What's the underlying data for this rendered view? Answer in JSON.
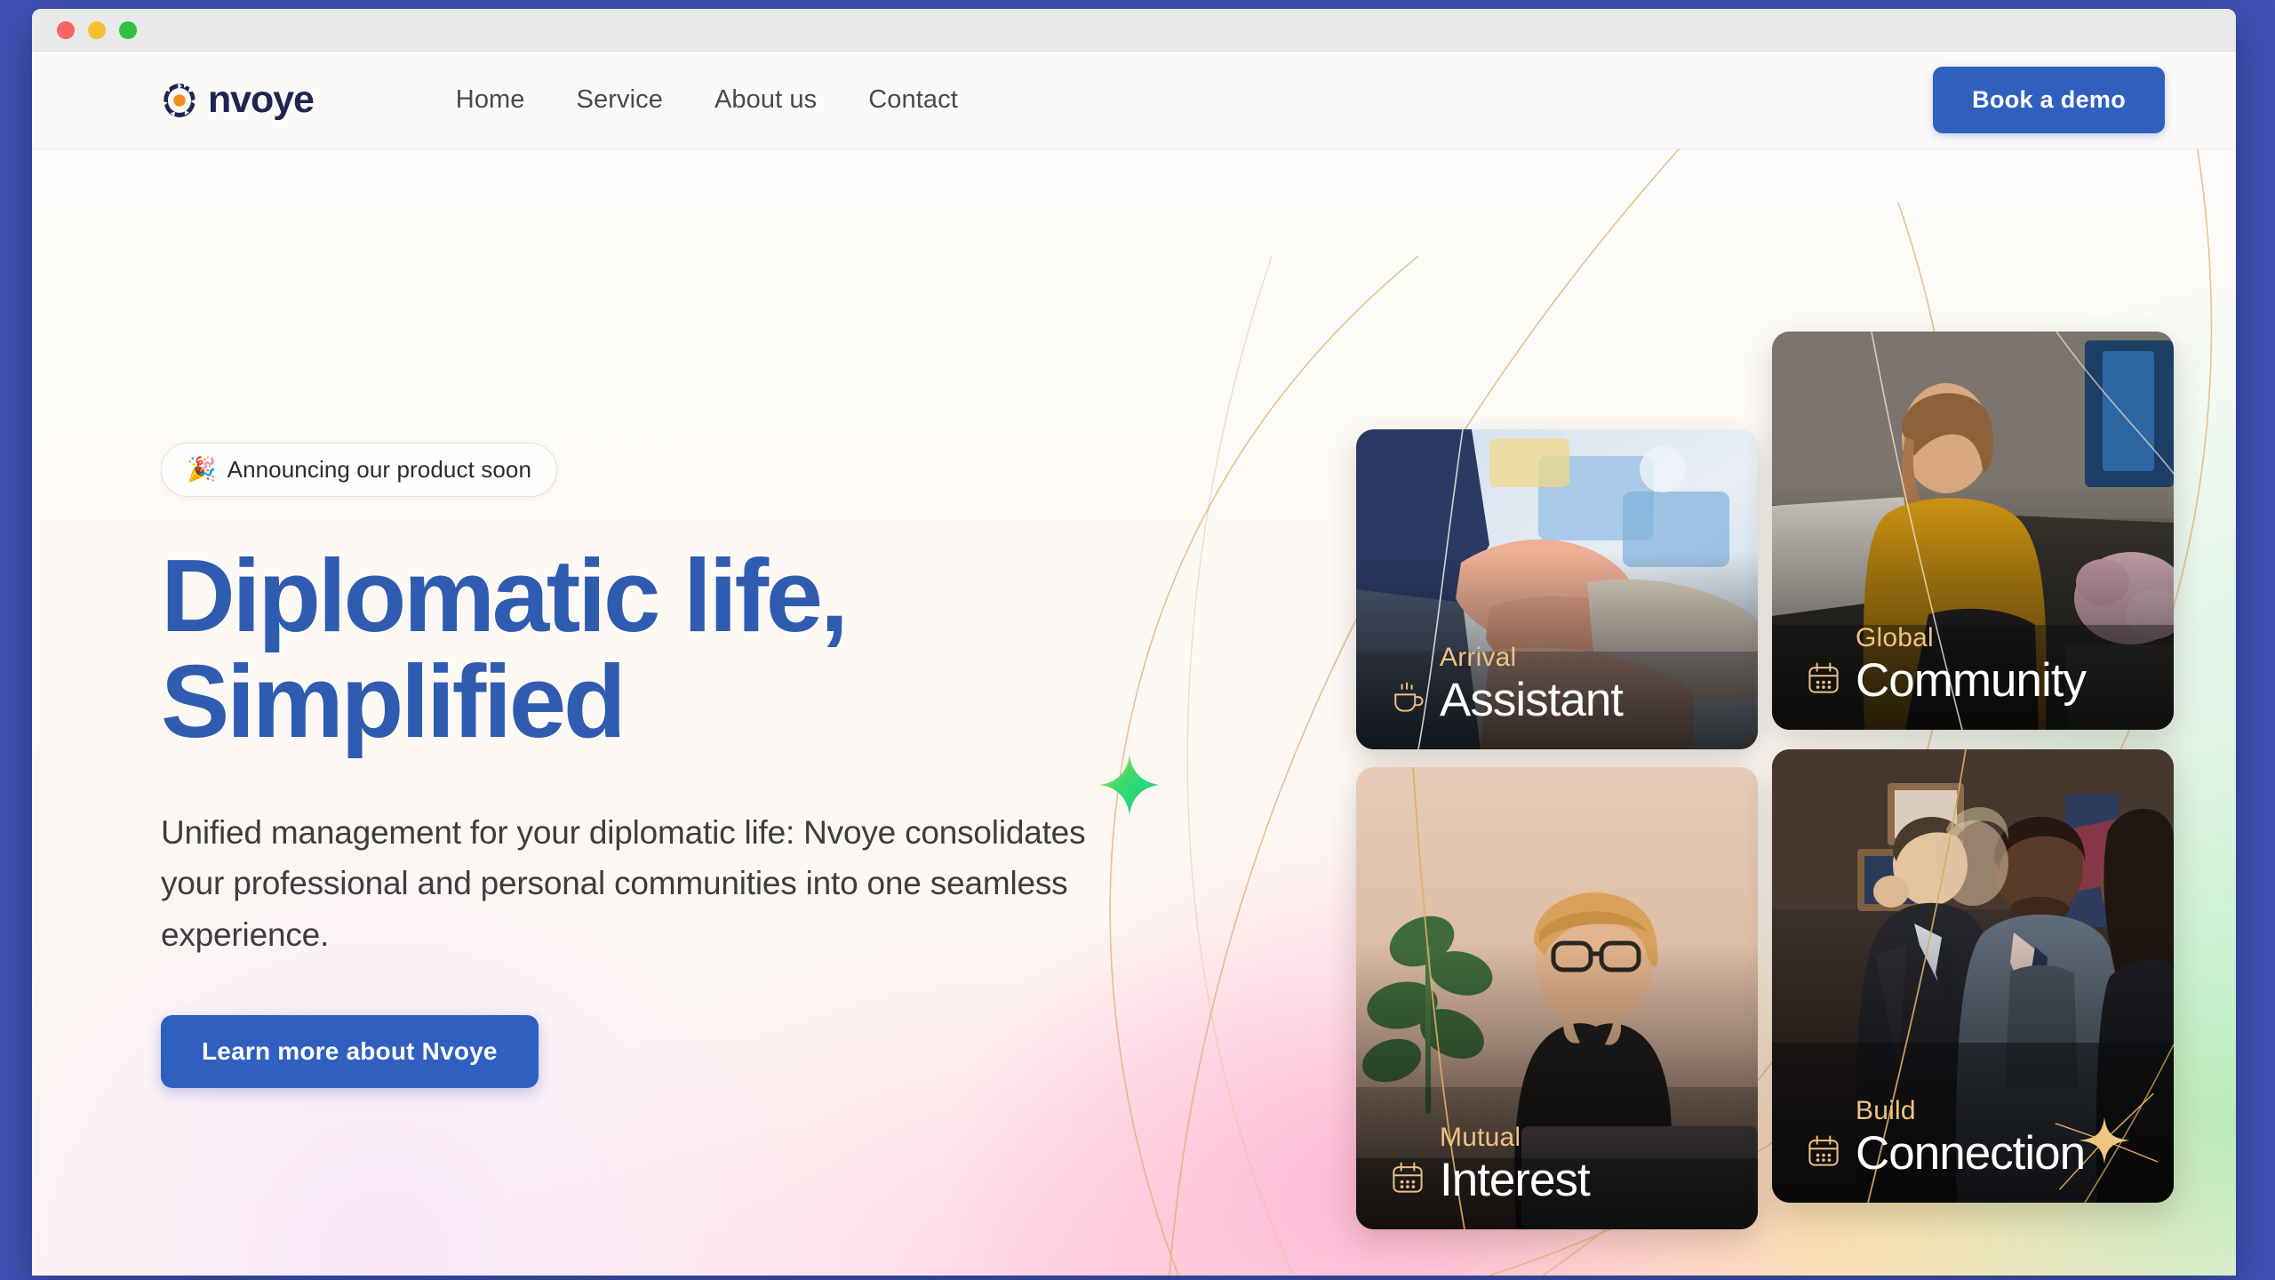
{
  "window": {
    "traffic_lights": [
      "close",
      "minimize",
      "maximize"
    ]
  },
  "header": {
    "brand_name": "nvoye",
    "brand_icon": "nvoye-swirl-logo-icon",
    "nav": [
      {
        "label": "Home"
      },
      {
        "label": "Service"
      },
      {
        "label": "About us"
      },
      {
        "label": "Contact"
      }
    ],
    "cta_label": "Book a  demo"
  },
  "hero": {
    "announcement": {
      "emoji": "🎉",
      "text": "Announcing our product soon"
    },
    "title_line_1": "Diplomatic life,",
    "title_line_2": "Simplified",
    "subtitle": "Unified management for your diplomatic life: Nvoye consolidates your professional and personal communities into one seamless experience.",
    "cta_label": "Learn more about Nvoye",
    "decor": {
      "green_sparkle": "four-point-star-sparkle-icon",
      "gold_sparkle": "gold-star-burst-icon"
    }
  },
  "cards": [
    {
      "id": "arrival-assistant",
      "kicker": "Arrival",
      "title": "Assistant",
      "icon": "coffee-cup-icon",
      "photo": "hands-stacked-together-meeting"
    },
    {
      "id": "global-community",
      "kicker": "Global",
      "title": "Community",
      "icon": "calendar-icon",
      "photo": "woman-in-mustard-top-at-desk"
    },
    {
      "id": "mutual-interest",
      "kicker": "Mutual",
      "title": "Interest",
      "icon": "calendar-icon",
      "photo": "smiling-woman-with-glasses-at-laptop"
    },
    {
      "id": "build-connection",
      "kicker": "Build",
      "title": "Connection",
      "icon": "calendar-icon",
      "photo": "business-people-in-suits-networking"
    }
  ],
  "colors": {
    "page_backdrop": "#3f51b5",
    "brand_navy": "#1f2550",
    "brand_orange": "#f28c1e",
    "accent_blue": "#2f60c0",
    "headline_blue": "#2f5cb0",
    "card_kicker_gold": "#f1c27f",
    "gold_line": "#d9ab5e"
  }
}
